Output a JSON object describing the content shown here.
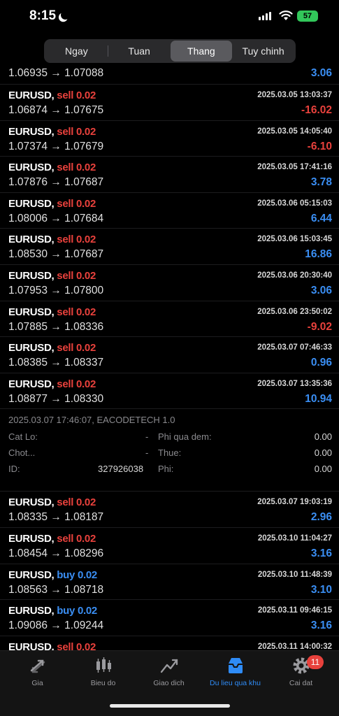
{
  "status": {
    "time": "8:15",
    "battery": "57"
  },
  "period_tabs": [
    "Ngay",
    "Tuan",
    "Thang",
    "Tuy chinh"
  ],
  "active_tab": "Thang",
  "top_partial": {
    "prices": "1.06935 → 1.07088",
    "pl": "3.06"
  },
  "trades_a": [
    {
      "pair": "EURUSD,",
      "side": "sell",
      "volume": "0.02",
      "datetime": "2025.03.05 13:03:37",
      "prices": "1.06874 → 1.07675",
      "pl": "-16.02"
    },
    {
      "pair": "EURUSD,",
      "side": "sell",
      "volume": "0.02",
      "datetime": "2025.03.05 14:05:40",
      "prices": "1.07374 → 1.07679",
      "pl": "-6.10"
    },
    {
      "pair": "EURUSD,",
      "side": "sell",
      "volume": "0.02",
      "datetime": "2025.03.05 17:41:16",
      "prices": "1.07876 → 1.07687",
      "pl": "3.78"
    },
    {
      "pair": "EURUSD,",
      "side": "sell",
      "volume": "0.02",
      "datetime": "2025.03.06 05:15:03",
      "prices": "1.08006 → 1.07684",
      "pl": "6.44"
    },
    {
      "pair": "EURUSD,",
      "side": "sell",
      "volume": "0.02",
      "datetime": "2025.03.06 15:03:45",
      "prices": "1.08530 → 1.07687",
      "pl": "16.86"
    },
    {
      "pair": "EURUSD,",
      "side": "sell",
      "volume": "0.02",
      "datetime": "2025.03.06 20:30:40",
      "prices": "1.07953 → 1.07800",
      "pl": "3.06"
    },
    {
      "pair": "EURUSD,",
      "side": "sell",
      "volume": "0.02",
      "datetime": "2025.03.06 23:50:02",
      "prices": "1.07885 → 1.08336",
      "pl": "-9.02"
    },
    {
      "pair": "EURUSD,",
      "side": "sell",
      "volume": "0.02",
      "datetime": "2025.03.07 07:46:33",
      "prices": "1.08385 → 1.08337",
      "pl": "0.96"
    },
    {
      "pair": "EURUSD,",
      "side": "sell",
      "volume": "0.02",
      "datetime": "2025.03.07 13:35:36",
      "prices": "1.08877 → 1.08330",
      "pl": "10.94"
    }
  ],
  "detail": {
    "header": "2025.03.07 17:46:07, EACODETECH 1.0",
    "sl_label": "Cat Lo:",
    "sl_value": "-",
    "tp_label": "Chot...",
    "tp_value": "-",
    "id_label": "ID:",
    "id_value": "327926038",
    "swap_label": "Phi qua dem:",
    "swap_value": "0.00",
    "tax_label": "Thue:",
    "tax_value": "0.00",
    "fee_label": "Phi:",
    "fee_value": "0.00"
  },
  "trades_b": [
    {
      "pair": "EURUSD,",
      "side": "sell",
      "volume": "0.02",
      "datetime": "2025.03.07 19:03:19",
      "prices": "1.08335 → 1.08187",
      "pl": "2.96"
    },
    {
      "pair": "EURUSD,",
      "side": "sell",
      "volume": "0.02",
      "datetime": "2025.03.10 11:04:27",
      "prices": "1.08454 → 1.08296",
      "pl": "3.16"
    },
    {
      "pair": "EURUSD,",
      "side": "buy",
      "volume": "0.02",
      "datetime": "2025.03.10 11:48:39",
      "prices": "1.08563 → 1.08718",
      "pl": "3.10"
    },
    {
      "pair": "EURUSD,",
      "side": "buy",
      "volume": "0.02",
      "datetime": "2025.03.11 09:46:15",
      "prices": "1.09086 → 1.09244",
      "pl": "3.16"
    },
    {
      "pair": "EURUSD,",
      "side": "sell",
      "volume": "0.02",
      "datetime": "2025.03.11 14:00:32",
      "prices": "",
      "pl": ""
    }
  ],
  "nav": [
    {
      "label": "Gia",
      "icon": "quotes-icon"
    },
    {
      "label": "Bieu do",
      "icon": "chart-icon"
    },
    {
      "label": "Giao dich",
      "icon": "trade-icon"
    },
    {
      "label": "Du lieu qua khu",
      "icon": "history-icon"
    },
    {
      "label": "Cai dat",
      "icon": "gear-icon"
    }
  ],
  "active_nav": "Du lieu qua khu",
  "settings_badge": "11",
  "colors": {
    "sell": "#e8413c",
    "buy": "#3a8ef3",
    "profit": "#3a8ef3",
    "loss": "#e8413c",
    "accent": "#2f8cf7"
  }
}
